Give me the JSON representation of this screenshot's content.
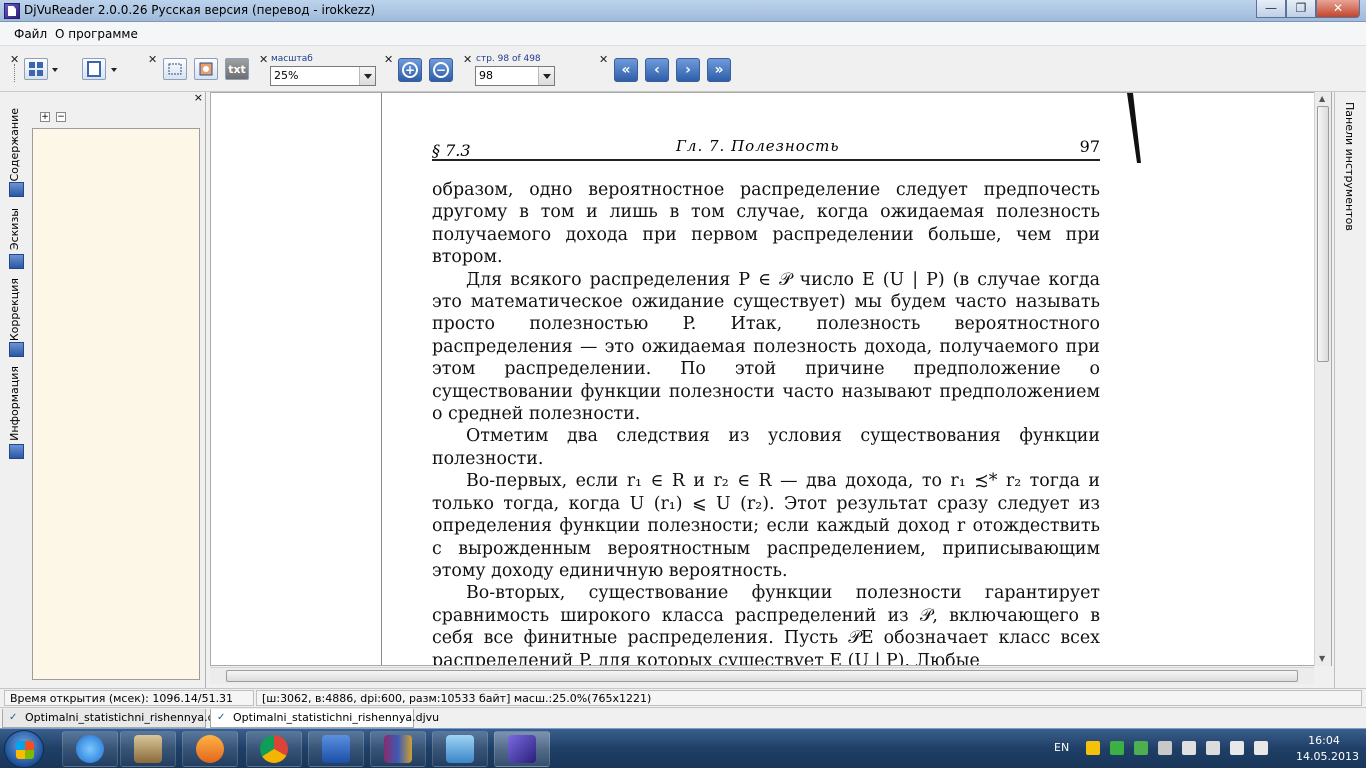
{
  "window": {
    "title": "DjVuReader 2.0.0.26 Русская версия (перевод - irokkezz)",
    "buttons": {
      "minimize": "—",
      "maximize": "❐",
      "close": "✕"
    }
  },
  "menu": {
    "file": "Файл",
    "about": "О программе"
  },
  "toolbar": {
    "zoom_label": "масштаб",
    "zoom_value": "25%",
    "page_label": "стр. 98 of 498",
    "page_value": "98",
    "txt_label": "txt",
    "zoom_in": "+",
    "zoom_out": "−",
    "nav": {
      "first": "«",
      "prev": "‹",
      "next": "›",
      "last": "»"
    }
  },
  "sidebar_tabs": [
    "Содержание",
    "Эскизы",
    "Коррекция",
    "Информация"
  ],
  "left_panel": {
    "close": "×",
    "expand": "+",
    "collapse": "−"
  },
  "right_panel": {
    "label": "Панели инструментов"
  },
  "page": {
    "section": "§ 7.3",
    "chapter": "Гл. 7. Полезность",
    "number": "97",
    "paragraphs": [
      "образом, одно вероятностное распределение следует предпочесть другому в том и лишь в том случае, когда ожидаемая полезность получаемого дохода при первом распределении больше, чем при втором.",
      "Для всякого распределения P ∈ 𝒫 число E (U | P) (в случае когда это математическое ожидание существует) мы будем часто называть просто полезностью P. Итак, полезность вероятностного распределения — это ожидаемая полезность дохода, получаемого при этом распределении. По этой причине предположение о существовании функции полезности часто называют предположением о средней полезности.",
      "Отметим два следствия из условия существования функции полезности.",
      "Во-первых, если r₁ ∈ R и r₂ ∈ R — два дохода, то r₁ ≾* r₂ тогда и только тогда, когда U (r₁) ⩽ U (r₂). Этот результат сразу следует из определения функции полезности; если каждый доход r отождествить с вырожденным вероятностным распределением, приписывающим этому доходу единичную вероятность.",
      "Во-вторых, существование функции полезности гарантирует сравнимость широкого класса распределений из 𝒫, включающего в себя все финитные распределения. Пусть 𝒫E обозначает класс всех распределений P, для которых существует E (U | P). Любые"
    ]
  },
  "status": {
    "open_time": "Время открытия (мсек): 1096.14/51.31",
    "info": "[ш:3062, в:4886, dpi:600, разм:10533 байт] масш.:25.0%(765x1221)"
  },
  "doc_tabs": [
    "Optimalni_statistichni_rishennya.djvu",
    "Optimalni_statistichni_rishennya.djvu"
  ],
  "taskbar": {
    "apps": [
      "explorer",
      "internet-explorer",
      "file-manager",
      "media-player",
      "chrome",
      "word",
      "winrar",
      "image-viewer",
      "djvureader"
    ],
    "lang": "EN",
    "time": "16:04",
    "date": "14.05.2013"
  }
}
